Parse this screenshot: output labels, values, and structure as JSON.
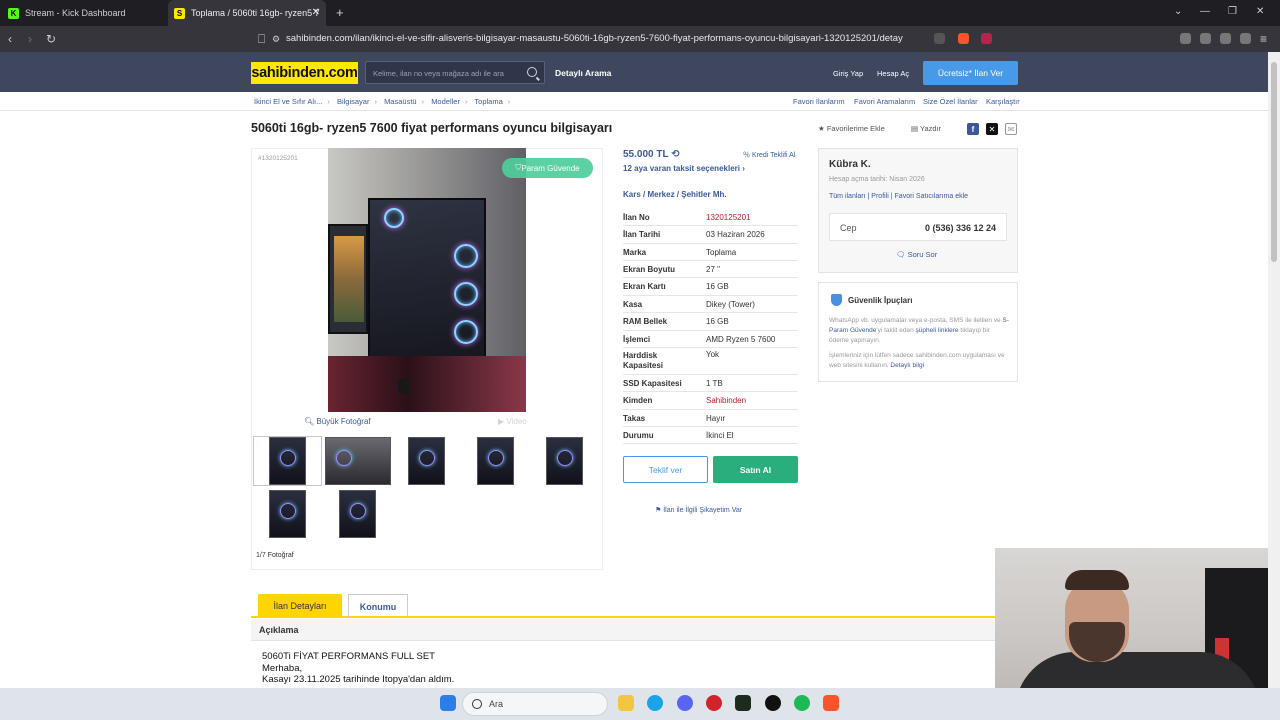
{
  "browser": {
    "tabs": [
      {
        "title": "Stream - Kick Dashboard",
        "favicon": "K"
      },
      {
        "title": "Toplama / 5060ti 16gb- ryzen5 7",
        "favicon": "S"
      }
    ],
    "url": "sahibinden.com/ilan/ikinci-el-ve-sifir-alisveris-bilgisayar-masaustu-5060ti-16gb-ryzen5-7600-fiyat-performans-oyuncu-bilgisayari-1320125201/detay"
  },
  "header": {
    "logo": "sahibinden.com",
    "search_placeholder": "Kelime, ilan no veya mağaza adı ile ara",
    "detailed_search": "Detaylı Arama",
    "login": "Giriş Yap",
    "register": "Hesap Aç",
    "cta": "Ücretsiz* İlan Ver"
  },
  "breadcrumb": [
    "İkinci El ve Sıfır Alı...",
    "Bilgisayar",
    "Masaüstü",
    "Modeller",
    "Toplama"
  ],
  "top_links": [
    "Favori İlanlarım",
    "Favori Aramalarım",
    "Size Özel İlanlar",
    "Karşılaştır"
  ],
  "listing": {
    "title": "5060ti 16gb- ryzen5 7600 fiyat performans oyuncu bilgisayarı",
    "add_favorite": "Favorilerime Ekle",
    "print": "Yazdır",
    "ad_no_small": "#1320125201",
    "safe_badge": "Param Güvende",
    "big_photo": "Büyük Fotoğraf",
    "video": "Video",
    "photo_count": "1/7 Fotoğraf",
    "price": "55.000 TL",
    "credit": "Kredi Teklifi Al",
    "installment": "12 aya varan taksit seçenekleri",
    "location": "Kars  /  Merkez  /  Şehitler Mh.",
    "details": [
      {
        "k": "İlan No",
        "v": "1320125201",
        "red": true
      },
      {
        "k": "İlan Tarihi",
        "v": "03 Haziran 2026"
      },
      {
        "k": "Marka",
        "v": "Toplama"
      },
      {
        "k": "Ekran Boyutu",
        "v": "27 \""
      },
      {
        "k": "Ekran Kartı",
        "v": "16 GB"
      },
      {
        "k": "Kasa",
        "v": "Dikey (Tower)"
      },
      {
        "k": "RAM Bellek",
        "v": "16 GB"
      },
      {
        "k": "İşlemci",
        "v": "AMD Ryzen 5 7600"
      },
      {
        "k": "Harddisk Kapasitesi",
        "v": "Yok"
      },
      {
        "k": "SSD Kapasitesi",
        "v": "1 TB"
      },
      {
        "k": "Kimden",
        "v": "Sahibinden",
        "red": true
      },
      {
        "k": "Takas",
        "v": "Hayır"
      },
      {
        "k": "Durumu",
        "v": "İkinci El"
      }
    ],
    "offer_button": "Teklif ver",
    "buy_button": "Satın Al",
    "complaint": "İlan ile İlgili Şikayetim Var"
  },
  "seller": {
    "name": "Kübra K.",
    "since": "Hesap açma tarihi: Nisan 2026",
    "links": [
      "Tüm ilanları",
      "Profili",
      "Favori Satıcılarıma ekle"
    ],
    "phone_label": "Cep",
    "phone": "0 (536) 336 12 24",
    "ask": "Soru Sor"
  },
  "tips": {
    "title": "Güvenlik İpuçları",
    "p1a": "WhatsApp vb. uygulamalar veya e-posta, SMS ile iletilen ve ",
    "p1b": "S-Param Güvende",
    "p1c": "'yi taklit eden ",
    "p1d": "şüpheli linklere",
    "p1e": " tıklayıp bir ödeme yapmayın.",
    "p2a": "İşlemleriniz için lütfen sadece sahibinden.com uygulaması ve web sitesini kullanın. ",
    "p2b": "Detaylı bilgi"
  },
  "detail_tabs": [
    "İlan Detayları",
    "Konumu"
  ],
  "description": {
    "header": "Açıklama",
    "lines": [
      "5060Ti FİYAT PERFORMANS FULL SET",
      "Merhaba,",
      "Kasayı 23.11.2025 tarihinde Itopya'dan aldım."
    ]
  },
  "taskbar": {
    "search": "Ara"
  }
}
